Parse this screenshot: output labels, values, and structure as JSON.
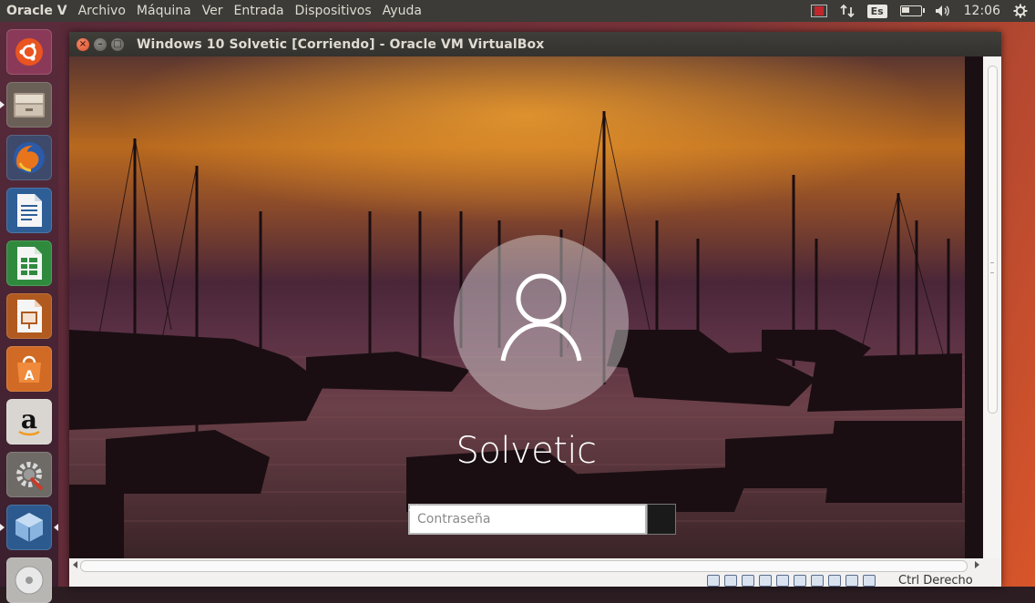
{
  "top_panel": {
    "app_name": "Oracle V",
    "menus": [
      "Archivo",
      "Máquina",
      "Ver",
      "Entrada",
      "Dispositivos",
      "Ayuda"
    ],
    "keyboard_layout": "Es",
    "time": "12:06"
  },
  "launcher": {
    "items": [
      {
        "name": "ubuntu-dash-icon"
      },
      {
        "name": "files-icon"
      },
      {
        "name": "firefox-icon"
      },
      {
        "name": "libreoffice-writer-icon"
      },
      {
        "name": "libreoffice-calc-icon"
      },
      {
        "name": "libreoffice-impress-icon"
      },
      {
        "name": "ubuntu-software-icon"
      },
      {
        "name": "amazon-icon"
      },
      {
        "name": "system-settings-icon"
      },
      {
        "name": "virtualbox-icon"
      },
      {
        "name": "dvd-icon"
      }
    ]
  },
  "window": {
    "title": "Windows 10 Solvetic [Corriendo] - Oracle VM VirtualBox"
  },
  "vm": {
    "username": "Solvetic",
    "password_placeholder": "Contraseña"
  },
  "statusbar": {
    "host_key": "Ctrl Derecho"
  },
  "colors": {
    "panel": "#3c3b37",
    "launcher": "#4a2535",
    "close_button": "#e0502c",
    "desktop_accent": "#d8552a"
  }
}
